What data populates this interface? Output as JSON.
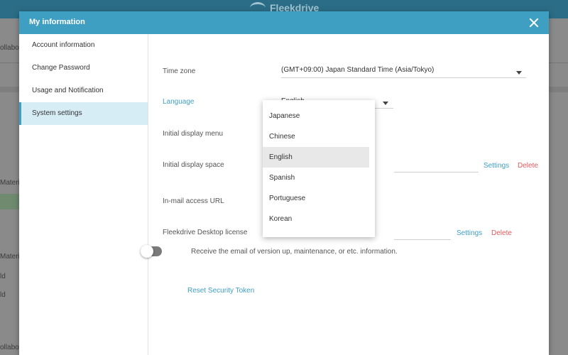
{
  "background": {
    "brand": "Fleekdrive",
    "fragments": [
      "ollabo",
      "Materi",
      "Materi",
      "ld",
      "ld",
      "ollabo"
    ]
  },
  "modal": {
    "title": "My information",
    "close_icon": "close-icon"
  },
  "sidebar": {
    "items": [
      {
        "label": "Account information"
      },
      {
        "label": "Change Password"
      },
      {
        "label": "Usage and Notification"
      },
      {
        "label": "System settings",
        "active": true
      }
    ]
  },
  "settings": {
    "time_zone": {
      "label": "Time zone",
      "value": "(GMT+09:00) Japan Standard Time (Asia/Tokyo)"
    },
    "language": {
      "label": "Language",
      "value": "English"
    },
    "initial_display_menu": {
      "label": "Initial display menu"
    },
    "initial_display_space": {
      "label": "Initial display space",
      "settings_link": "Settings",
      "delete_link": "Delete"
    },
    "in_mail_access_url": {
      "label": "In-mail access URL"
    },
    "desktop_license": {
      "label": "Fleekdrive Desktop license",
      "settings_link": "Settings",
      "delete_link": "Delete"
    },
    "email_toggle": {
      "label": "Receive the email of version up, maintenance, or etc. information.",
      "enabled": false
    },
    "reset_security_token": "Reset Security Token"
  },
  "language_dropdown": {
    "options": [
      "Japanese",
      "Chinese",
      "English",
      "Spanish",
      "Portuguese",
      "Korean"
    ],
    "selected": "English"
  },
  "colors": {
    "accent": "#3f9fc3",
    "danger": "#e05a5a",
    "header": "#3f9fc3"
  }
}
